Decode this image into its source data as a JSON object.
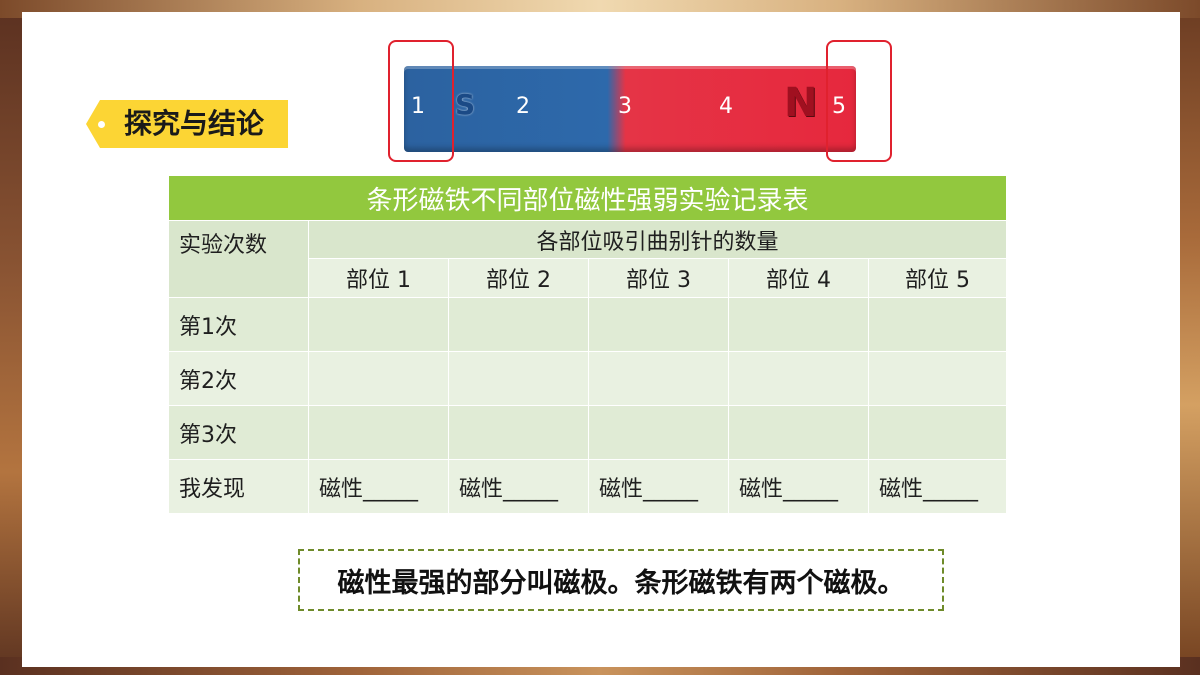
{
  "section_tag": "探究与结论",
  "magnet": {
    "labels": [
      "1",
      "2",
      "3",
      "4",
      "5"
    ],
    "pole_left": "S",
    "pole_right": "N",
    "colors": {
      "left": "#2d69ab",
      "right": "#e6283d",
      "highlight": "#e0212e"
    }
  },
  "table": {
    "title": "条形磁铁不同部位磁性强弱实验记录表",
    "row_header": "实验次数",
    "group_header": "各部位吸引曲别针的数量",
    "columns": [
      "部位 1",
      "部位 2",
      "部位 3",
      "部位 4",
      "部位 5"
    ],
    "rows": [
      {
        "label": "第1次",
        "cells": [
          "",
          "",
          "",
          "",
          ""
        ]
      },
      {
        "label": "第2次",
        "cells": [
          "",
          "",
          "",
          "",
          ""
        ]
      },
      {
        "label": "第3次",
        "cells": [
          "",
          "",
          "",
          "",
          ""
        ]
      }
    ],
    "finding_label": "我发现",
    "findings": [
      "磁性_____",
      "磁性_____",
      "磁性_____",
      "磁性_____",
      "磁性_____"
    ],
    "colors": {
      "title_bg": "#92c83e",
      "cell_bg": "#e0ebd5"
    }
  },
  "conclusion": "磁性最强的部分叫磁极。条形磁铁有两个磁极。"
}
